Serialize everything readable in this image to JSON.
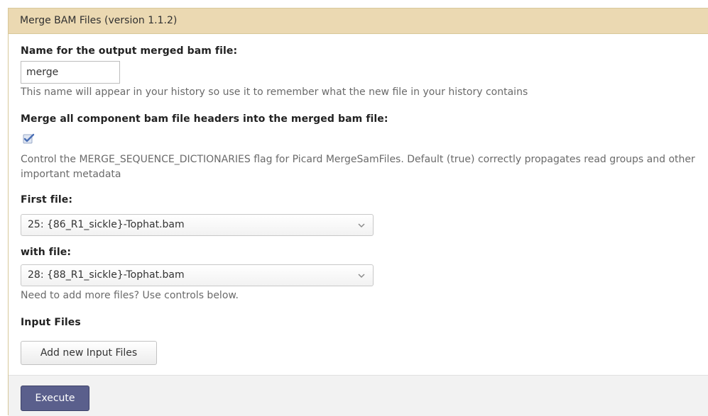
{
  "tool": {
    "title": "Merge BAM Files (version 1.1.2)"
  },
  "output_name": {
    "label": "Name for the output merged bam file:",
    "value": "merge",
    "help": "This name will appear in your history so use it to remember what the new file in your history contains"
  },
  "merge_headers": {
    "label": "Merge all component bam file headers into the merged bam file:",
    "checked": true,
    "help": "Control the MERGE_SEQUENCE_DICTIONARIES flag for Picard MergeSamFiles. Default (true) correctly propagates read groups and other important metadata"
  },
  "first_file": {
    "label": "First file:",
    "selected": "25: {86_R1_sickle}-Tophat.bam"
  },
  "with_file": {
    "label": "with file:",
    "selected": "28: {88_R1_sickle}-Tophat.bam",
    "help": "Need to add more files? Use controls below."
  },
  "input_files": {
    "label": "Input Files",
    "add_button": "Add new Input Files"
  },
  "footer": {
    "execute_button": "Execute"
  },
  "icons": {
    "checkbox": "checkmark-icon",
    "dropdown": "chevron-down-icon"
  },
  "colors": {
    "title_bg": "#ebd9b2",
    "execute_bg": "#5a5f8c"
  }
}
